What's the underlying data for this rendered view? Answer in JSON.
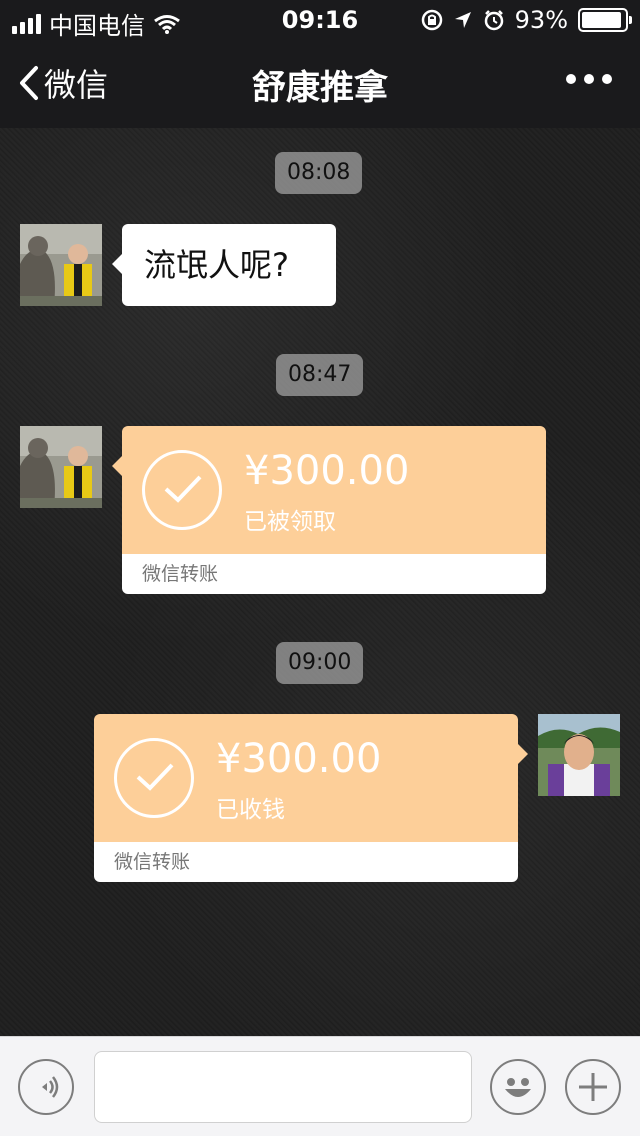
{
  "status_bar": {
    "carrier": "中国电信",
    "time": "09:16",
    "battery_text": "93%",
    "battery_level": 0.93
  },
  "nav": {
    "back_label": "微信",
    "title": "舒康推拿"
  },
  "messages": [
    {
      "timestamp": "08:08",
      "text": "流氓人呢?"
    },
    {
      "timestamp": "08:47",
      "amount": "¥300.00",
      "status": "已被领取",
      "footer": "微信转账"
    },
    {
      "timestamp": "09:00",
      "amount": "¥300.00",
      "status": "已收钱",
      "footer": "微信转账"
    }
  ],
  "icons": {
    "back": "chevron-left-icon",
    "more": "more-icon",
    "voice": "voice-icon",
    "emoji": "emoji-icon",
    "plus": "plus-icon",
    "check": "check-icon"
  },
  "colors": {
    "transfer": "#fdcf99",
    "nav_background": "#1a1a1c",
    "input_background": "#f4f4f6"
  }
}
